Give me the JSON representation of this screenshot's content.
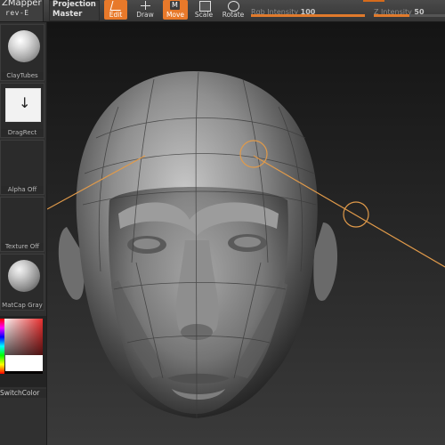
{
  "menu": {
    "app_title": "ZMapper",
    "app_version": "rev-E",
    "projection_label": "Projection",
    "projection_value": "Master"
  },
  "toolbar": {
    "edit_label": "Edit",
    "draw_label": "Draw",
    "move_label": "Move",
    "scale_label": "Scale",
    "rotate_label": "Rotate",
    "move_icon_text": "M"
  },
  "sliders": {
    "rgb_label": "Rgb Intensity",
    "rgb_value": "100",
    "z_label": "Z Intensity",
    "z_value": "50",
    "rgb_fraction": 1.0,
    "z_fraction": 0.5
  },
  "tray": {
    "brush_label": "ClayTubes",
    "stroke_label": "DragRect",
    "alpha_label": "Alpha Off",
    "texture_label": "Texture Off",
    "material_label": "MatCap Gray",
    "switch_label": "SwitchColor"
  },
  "colors": {
    "accent": "#e8792a",
    "gizmo": "#e09a4a",
    "main_color": "#ffffff",
    "secondary_color": "#000000"
  }
}
